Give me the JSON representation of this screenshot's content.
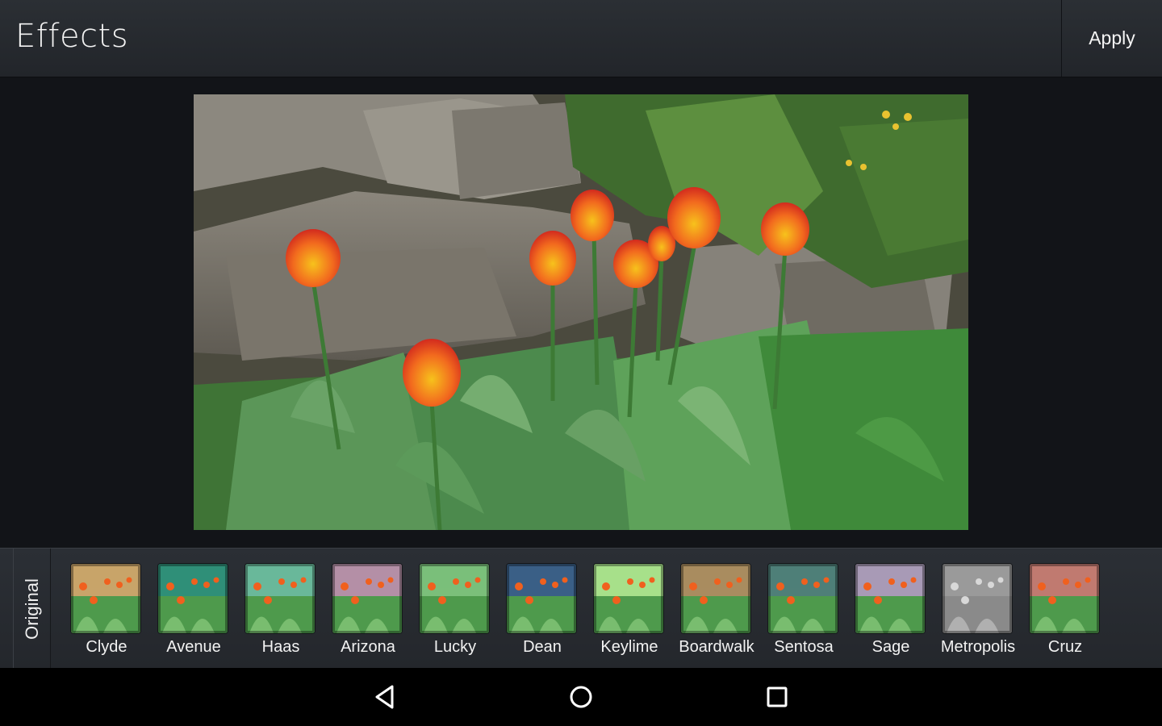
{
  "header": {
    "title": "Effects",
    "apply_label": "Apply"
  },
  "photo": {
    "subject": "tulips-photo"
  },
  "filmstrip": {
    "original_label": "Original",
    "effects": [
      {
        "label": "Clyde",
        "tint": "#c8a46a"
      },
      {
        "label": "Avenue",
        "tint": "#2f8f78"
      },
      {
        "label": "Haas",
        "tint": "#6ab89a"
      },
      {
        "label": "Arizona",
        "tint": "#b48fa6"
      },
      {
        "label": "Lucky",
        "tint": "#7bbf7a"
      },
      {
        "label": "Dean",
        "tint": "#3a5f86"
      },
      {
        "label": "Keylime",
        "tint": "#a7e08a"
      },
      {
        "label": "Boardwalk",
        "tint": "#a98c60"
      },
      {
        "label": "Sentosa",
        "tint": "#4f7f78"
      },
      {
        "label": "Sage",
        "tint": "#a89ab6"
      },
      {
        "label": "Metropolis",
        "tint": "#9a9a9a"
      },
      {
        "label": "Cruz",
        "tint": "#c07a70"
      }
    ]
  },
  "navbar": {
    "back_icon": "back-triangle-icon",
    "home_icon": "home-circle-icon",
    "recents_icon": "recents-square-icon"
  }
}
